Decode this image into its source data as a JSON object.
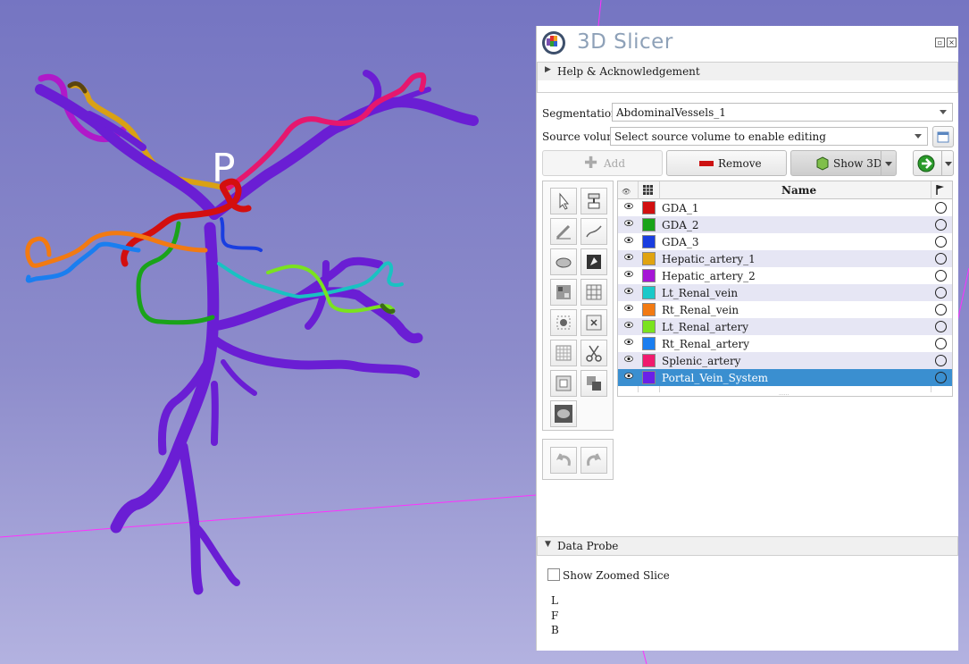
{
  "viewer": {
    "orientation_marker": "P"
  },
  "module_panel": {
    "app_name": "3D Slicer",
    "help_section_title": "Help & Acknowledgement",
    "segmentation_label": "Segmentation:",
    "segmentation_value": "AbdominalVessels_1",
    "source_volume_label": "Source volume:",
    "source_volume_value": "Select source volume to enable editing",
    "add_label": "Add",
    "remove_label": "Remove",
    "show3d_label": "Show 3D",
    "table_header_name": "Name",
    "segments": [
      {
        "name": "GDA_1",
        "color": "#d10f0f"
      },
      {
        "name": "GDA_2",
        "color": "#18a318"
      },
      {
        "name": "GDA_3",
        "color": "#1a3ee0"
      },
      {
        "name": "Hepatic_artery_1",
        "color": "#e0a30f"
      },
      {
        "name": "Hepatic_artery_2",
        "color": "#a616d6"
      },
      {
        "name": "Lt_Renal_vein",
        "color": "#19c9c9"
      },
      {
        "name": "Rt_Renal_vein",
        "color": "#f27a12"
      },
      {
        "name": "Lt_Renal_artery",
        "color": "#7ae31e"
      },
      {
        "name": "Rt_Renal_artery",
        "color": "#1a7ef0"
      },
      {
        "name": "Splenic_artery",
        "color": "#f01a6e"
      },
      {
        "name": "Portal_Vein_System",
        "color": "#6a20e8"
      }
    ],
    "selected_segment": "Portal_Vein_System",
    "data_probe_title": "Data Probe",
    "show_zoomed_slice_label": "Show Zoomed Slice",
    "probe_lines": [
      "L",
      "F",
      "B"
    ]
  }
}
